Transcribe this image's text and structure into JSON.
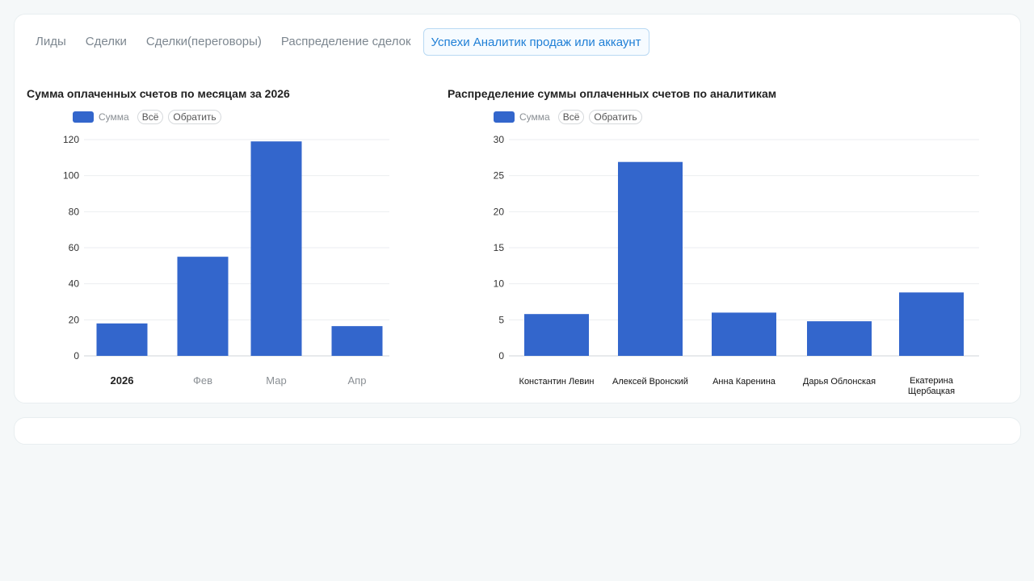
{
  "tabs": [
    {
      "label": "Лиды",
      "active": false
    },
    {
      "label": "Сделки",
      "active": false
    },
    {
      "label": "Сделки(переговоры)",
      "active": false
    },
    {
      "label": "Распределение сделок",
      "active": false
    },
    {
      "label": "Успехи Аналитик продаж или аккаунт",
      "active": true
    }
  ],
  "colors": {
    "bar": "#3366cc",
    "accent": "#1f7fd6"
  },
  "chart_data": [
    {
      "type": "bar",
      "title": "Сумма оплаченных счетов по месяцам за 2026",
      "legend": {
        "series_label": "Сумма",
        "all_label": "Всё",
        "invert_label": "Обратить",
        "position": "top-left"
      },
      "categories": [
        "2026",
        "Фев",
        "Мар",
        "Апр"
      ],
      "series": [
        {
          "name": "Сумма",
          "values": [
            18,
            55,
            119,
            16.5
          ]
        }
      ],
      "ylim": [
        0,
        120
      ],
      "yticks": [
        0,
        20,
        40,
        60,
        80,
        100,
        120
      ],
      "grid": true
    },
    {
      "type": "bar",
      "title": "Распределение суммы оплаченных счетов по аналитикам",
      "legend": {
        "series_label": "Сумма",
        "all_label": "Всё",
        "invert_label": "Обратить",
        "position": "top-left"
      },
      "categories": [
        "Константин Левин",
        "Алексей Вронский",
        "Анна Каренина",
        "Дарья Облонская",
        "Екатерина Щербацкая"
      ],
      "series": [
        {
          "name": "Сумма",
          "values": [
            5.8,
            26.9,
            6,
            4.8,
            8.8
          ]
        }
      ],
      "ylim": [
        0,
        30
      ],
      "yticks": [
        0,
        5,
        10,
        15,
        20,
        25,
        30
      ],
      "grid": true
    }
  ]
}
